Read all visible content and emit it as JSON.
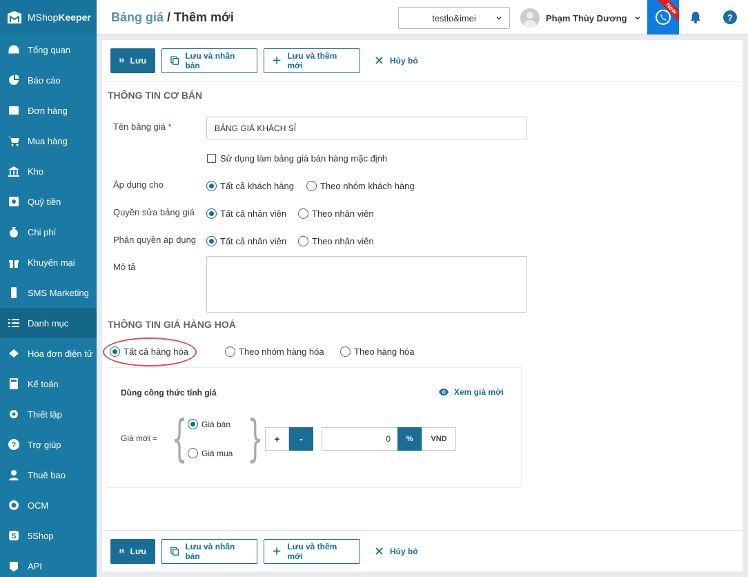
{
  "app": {
    "brand_prefix": "MShop",
    "brand_suffix": "Keeper"
  },
  "sidebar": {
    "items": [
      {
        "label": "Tổng quan",
        "icon": "dashboard-icon"
      },
      {
        "label": "Báo cáo",
        "icon": "pie-chart-icon"
      },
      {
        "label": "Đơn hàng",
        "icon": "order-icon"
      },
      {
        "label": "Mua hàng",
        "icon": "cart-icon"
      },
      {
        "label": "Kho",
        "icon": "warehouse-icon"
      },
      {
        "label": "Quỹ tiền",
        "icon": "safe-icon"
      },
      {
        "label": "Chi phí",
        "icon": "money-bag-icon"
      },
      {
        "label": "Khuyến mại",
        "icon": "gift-icon"
      },
      {
        "label": "SMS Marketing",
        "icon": "phone-icon"
      },
      {
        "label": "Danh mục",
        "icon": "list-icon",
        "active": true
      },
      {
        "label": "Hóa đơn điện tử",
        "icon": "invoice-icon"
      },
      {
        "label": "Kế toán",
        "icon": "calculator-icon"
      },
      {
        "label": "Thiết lập",
        "icon": "gear-icon"
      },
      {
        "label": "Trợ giúp",
        "icon": "help-icon"
      },
      {
        "label": "Thuê bao",
        "icon": "user-icon"
      },
      {
        "label": "OCM",
        "icon": "ocm-icon"
      },
      {
        "label": "5Shop",
        "icon": "5shop-icon"
      },
      {
        "label": "API",
        "icon": "api-icon"
      }
    ]
  },
  "header": {
    "breadcrumb": "Bảng giá",
    "separator": " / ",
    "title": "Thêm mới",
    "store": "testlo&imei",
    "user_name": "Phạm Thùy Dương",
    "new_badge": "New"
  },
  "toolbar": {
    "save": "Lưu",
    "save_duplicate": "Lưu và nhân bản",
    "save_add_new": "Lưu và thêm mới",
    "cancel": "Hủy bỏ"
  },
  "basic_info": {
    "section_title": "THÔNG TIN CƠ BẢN",
    "name_label": "Tên bảng giá",
    "name_required": "*",
    "name_value": "BẢNG GIÁ KHÁCH SỈ",
    "default_checkbox_label": "Sử dụng làm bảng giá bán hàng mặc định",
    "default_checked": false,
    "apply_to_label": "Áp dụng cho",
    "apply_to_options": [
      "Tất cả khách hàng",
      "Theo nhóm khách hàng"
    ],
    "apply_to_selected": 0,
    "edit_permission_label": "Quyền sửa bảng giá",
    "edit_permission_options": [
      "Tất cả nhân viên",
      "Theo nhân viên"
    ],
    "edit_permission_selected": 0,
    "apply_permission_label": "Phân quyền áp dụng",
    "apply_permission_options": [
      "Tất cả nhân viên",
      "Theo nhân viên"
    ],
    "apply_permission_selected": 0,
    "description_label": "Mô tả",
    "description_value": ""
  },
  "price_info": {
    "section_title": "THÔNG TIN GIÁ HÀNG HOÁ",
    "scope_options": [
      "Tất cả hàng hóa",
      "Theo nhóm hàng hóa",
      "Theo hàng hóa"
    ],
    "scope_selected": 0,
    "formula_title": "Dùng công thức tính giá",
    "view_new_price": "Xem giá mới",
    "new_price_label": "Giá mới =",
    "base_options": [
      "Giá bán",
      "Giá mua"
    ],
    "base_selected": 0,
    "plus": "+",
    "minus": "-",
    "operator_selected": "-",
    "amount": "0",
    "unit_percent": "%",
    "unit_vnd": "VND",
    "unit_selected": "%"
  },
  "colors": {
    "sidebar": "#1b7aa3",
    "accent": "#1a6e96",
    "highlight": "#d9534f",
    "phone_button": "#0e7ce0"
  }
}
